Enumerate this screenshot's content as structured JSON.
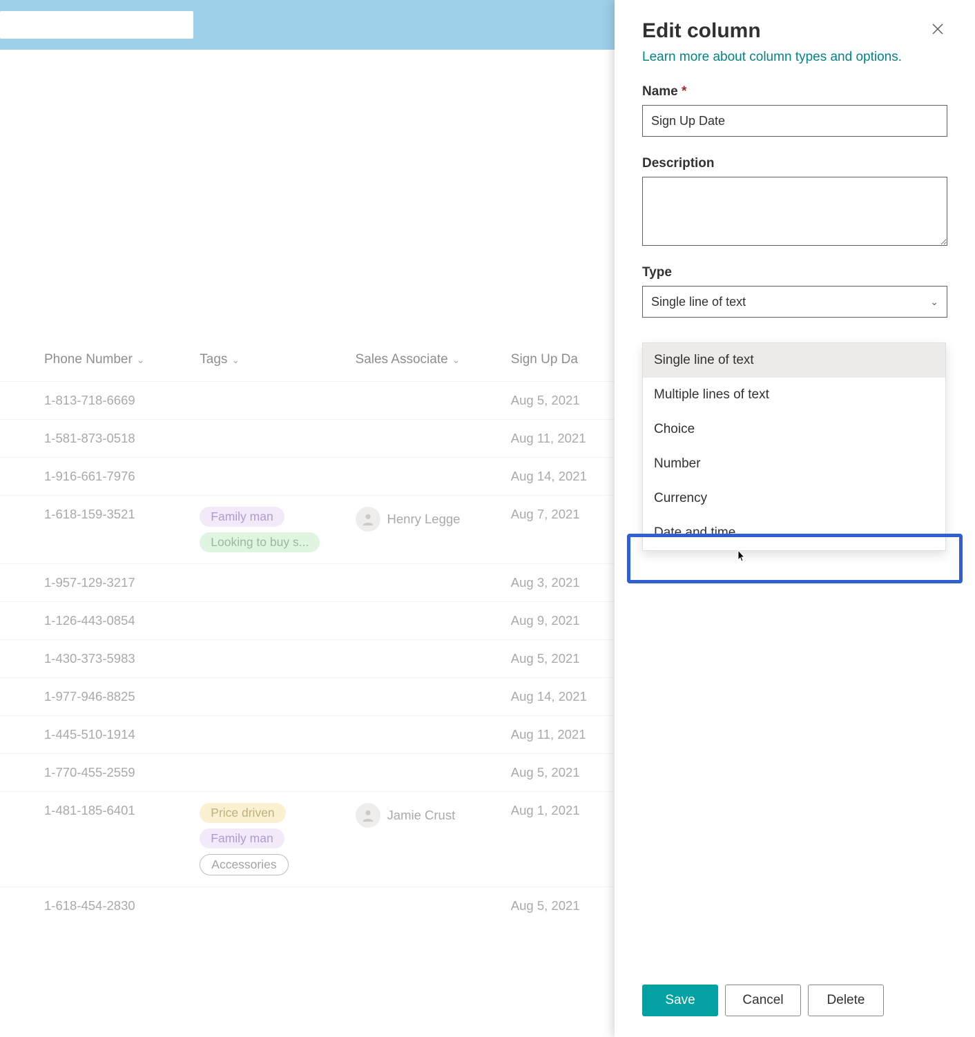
{
  "panel": {
    "title": "Edit column",
    "learn_more": "Learn more about column types and options.",
    "name_label": "Name",
    "name_value": "Sign Up Date",
    "description_label": "Description",
    "description_value": "",
    "type_label": "Type",
    "type_selected": "Single line of text",
    "type_options": [
      "Single line of text",
      "Multiple lines of text",
      "Choice",
      "Number",
      "Currency",
      "Date and time"
    ],
    "buttons": {
      "save": "Save",
      "cancel": "Cancel",
      "delete": "Delete"
    }
  },
  "table": {
    "headers": {
      "phone": "Phone Number",
      "tags": "Tags",
      "associate": "Sales Associate",
      "signup": "Sign Up Da"
    },
    "rows": [
      {
        "phone": "1-813-718-6669",
        "tags": [],
        "associate": "",
        "signup": "Aug 5, 2021"
      },
      {
        "phone": "1-581-873-0518",
        "tags": [],
        "associate": "",
        "signup": "Aug 11, 2021"
      },
      {
        "phone": "1-916-661-7976",
        "tags": [],
        "associate": "",
        "signup": "Aug 14, 2021"
      },
      {
        "phone": "1-618-159-3521",
        "tags": [
          {
            "text": "Family man",
            "color": "purple"
          },
          {
            "text": "Looking to buy s...",
            "color": "green"
          }
        ],
        "associate": "Henry Legge",
        "signup": "Aug 7, 2021"
      },
      {
        "phone": "1-957-129-3217",
        "tags": [],
        "associate": "",
        "signup": "Aug 3, 2021"
      },
      {
        "phone": "1-126-443-0854",
        "tags": [],
        "associate": "",
        "signup": "Aug 9, 2021"
      },
      {
        "phone": "1-430-373-5983",
        "tags": [],
        "associate": "",
        "signup": "Aug 5, 2021"
      },
      {
        "phone": "1-977-946-8825",
        "tags": [],
        "associate": "",
        "signup": "Aug 14, 2021"
      },
      {
        "phone": "1-445-510-1914",
        "tags": [],
        "associate": "",
        "signup": "Aug 11, 2021"
      },
      {
        "phone": "1-770-455-2559",
        "tags": [],
        "associate": "",
        "signup": "Aug 5, 2021"
      },
      {
        "phone": "1-481-185-6401",
        "tags": [
          {
            "text": "Price driven",
            "color": "yellow"
          },
          {
            "text": "Family man",
            "color": "purple"
          },
          {
            "text": "Accessories",
            "color": "outline"
          }
        ],
        "associate": "Jamie Crust",
        "signup": "Aug 1, 2021"
      },
      {
        "phone": "1-618-454-2830",
        "tags": [],
        "associate": "",
        "signup": "Aug 5, 2021"
      }
    ]
  }
}
